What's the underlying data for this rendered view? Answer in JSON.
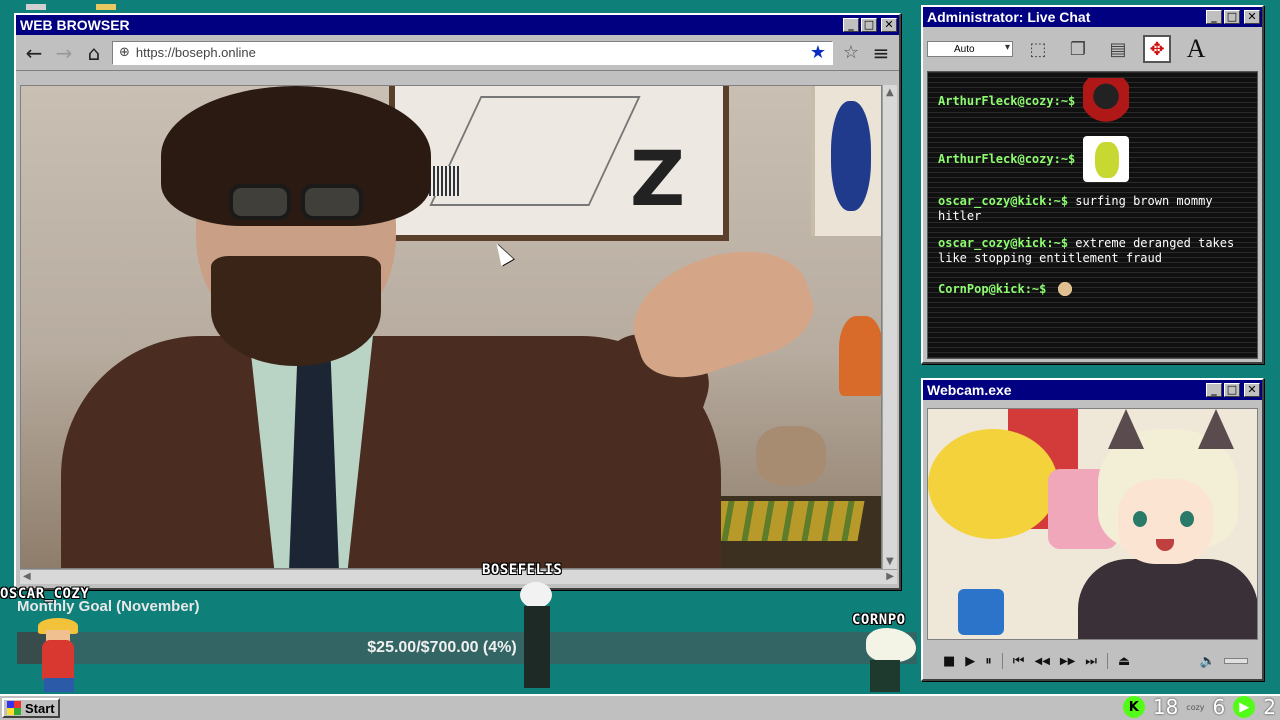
{
  "browser": {
    "title": "WEB BROWSER",
    "url": "https://boseph.online",
    "icons": {
      "back": "back-arrow-icon",
      "forward": "forward-arrow-icon",
      "home": "home-icon",
      "globe": "globe-icon",
      "bookmark_filled": "star-filled-icon",
      "bookmark": "star-outline-icon",
      "menu": "hamburger-menu-icon"
    },
    "accent": "#0000a8"
  },
  "chat": {
    "title": "Administrator: Live Chat",
    "font_size_select": "Auto",
    "messages": [
      {
        "user": "ArthurFleck@cozy:~$",
        "text": "",
        "emote": "red-character-emote"
      },
      {
        "user": "ArthurFleck@cozy:~$",
        "text": "",
        "emote": "yellow-raincoat-emote"
      },
      {
        "user": "oscar_cozy@kick:~$",
        "text": "surfing brown mommy hitler"
      },
      {
        "user": "oscar_cozy@kick:~$",
        "text": "extreme deranged takes like stopping entitlement fraud"
      },
      {
        "user": "CornPop@kick:~$",
        "text": "",
        "emote": "hamster-emote"
      }
    ],
    "user_color": "#8dfc6f"
  },
  "webcam": {
    "title": "Webcam.exe",
    "controls": {
      "stop": "■",
      "play": "▶",
      "pause": "⏸",
      "prev": "⏮",
      "rewind": "◀◀",
      "forward": "▶▶",
      "next": "⏭",
      "eject": "⏏",
      "volume": "🔈"
    }
  },
  "overlay": {
    "name_oscar": "OSCAR_COZY",
    "name_bosefelis": "BOSEFELIS",
    "name_cornpop": "CORNPO",
    "goal_title": "Monthly Goal (November)",
    "goal_text": "$25.00/$700.00 (4%)",
    "goal_progress": 0.04
  },
  "taskbar": {
    "start_label": "Start",
    "viewers_kick": "18",
    "viewers_other": "6",
    "viewers_third": "2",
    "cozy_label": "cozy"
  }
}
